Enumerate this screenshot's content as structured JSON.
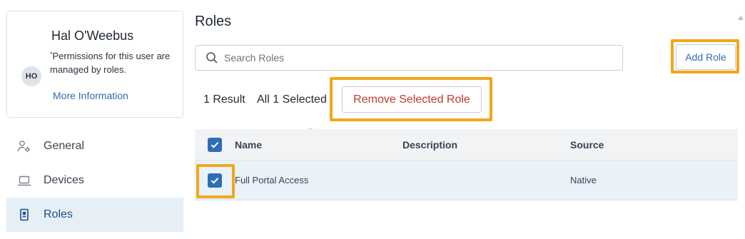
{
  "user_card": {
    "name": "Hal O'Weebus",
    "initials": "HO",
    "permission_asterisk": "*",
    "permission_note": "Permissions for this user are managed by roles.",
    "more_info_link": "More Information"
  },
  "sidebar": {
    "items": [
      {
        "label": "General",
        "icon": "user-gear-icon",
        "active": false
      },
      {
        "label": "Devices",
        "icon": "laptop-icon",
        "active": false
      },
      {
        "label": "Roles",
        "icon": "id-badge-icon",
        "active": true
      }
    ]
  },
  "main": {
    "title": "Roles",
    "search": {
      "placeholder": "Search Roles",
      "value": ""
    },
    "add_role_label": "Add Role",
    "result_count": "1 Result",
    "selected_count": "All 1 Selected",
    "remove_selected_label": "Remove Selected Role",
    "table": {
      "columns": [
        "Name",
        "Description",
        "Source"
      ],
      "rows": [
        {
          "name": "Full Portal Access",
          "description": "",
          "source": "Native",
          "checked": true
        }
      ],
      "all_checked": true
    }
  },
  "colors": {
    "accent": "#2f6db5",
    "highlight": "#f0a818",
    "danger": "#c0392b",
    "active_nav_bg": "#e6eef6",
    "row_selected_bg": "#e9f1f9"
  }
}
